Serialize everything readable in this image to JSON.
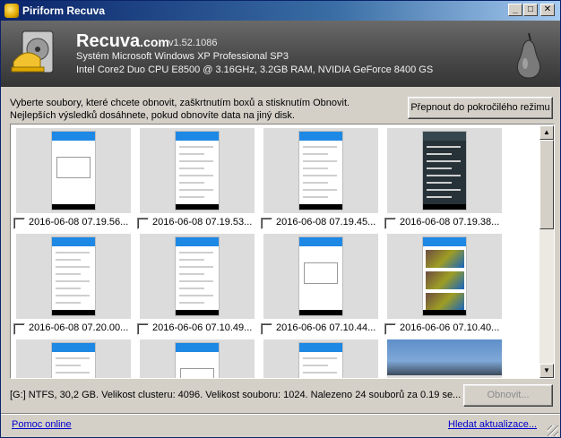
{
  "window": {
    "title": "Piriform Recuva",
    "controls": {
      "minimize": "_",
      "maximize": "□",
      "close": "✕"
    }
  },
  "header": {
    "brand": "Recuva",
    "brand_suffix": ".com",
    "version": "v1.52.1086",
    "os_line": "Systém Microsoft Windows XP Professional SP3",
    "hw_line": "Intel Core2 Duo CPU E8500 @ 3.16GHz, 3.2GB RAM, NVIDIA GeForce 8400 GS",
    "logo_icon": "recuva-logo-icon",
    "pear_icon": "piriform-pear-icon"
  },
  "instructions": {
    "line1": "Vyberte soubory, které chcete obnovit, zaškrtnutím boxů a stisknutím Obnovit.",
    "line2": "Nejlepších výsledků dosáhnete, pokud obnovíte data na jiný disk."
  },
  "advanced_button": "Přepnout do pokročilého režimu",
  "thumbnails": [
    {
      "name": "2016-06-08 07.19.56...",
      "checked": false,
      "style": "dialog"
    },
    {
      "name": "2016-06-08 07.19.53...",
      "checked": false,
      "style": "settings"
    },
    {
      "name": "2016-06-08 07.19.45...",
      "checked": false,
      "style": "list"
    },
    {
      "name": "2016-06-08 07.19.38...",
      "checked": false,
      "style": "dark"
    },
    {
      "name": "2016-06-08 07.20.00...",
      "checked": false,
      "style": "settings"
    },
    {
      "name": "2016-06-06 07.10.49...",
      "checked": false,
      "style": "settings"
    },
    {
      "name": "2016-06-06 07.10.44...",
      "checked": false,
      "style": "dialog"
    },
    {
      "name": "2016-06-06 07.10.40...",
      "checked": false,
      "style": "gallery"
    },
    {
      "name": "",
      "checked": false,
      "style": "settings"
    },
    {
      "name": "",
      "checked": false,
      "style": "dialog"
    },
    {
      "name": "",
      "checked": false,
      "style": "list"
    },
    {
      "name": "",
      "checked": false,
      "style": "landscape"
    }
  ],
  "scrollbar": {
    "up": "▲",
    "down": "▼"
  },
  "status_text": "[G:] NTFS, 30,2 GB. Velikost clusteru: 4096. Velikost souboru: 1024. Nalezeno 24 souborů za 0.19 se...",
  "recover_button": "Obnovit...",
  "footer": {
    "help_link": "Pomoc online",
    "update_link": "Hledat aktualizace..."
  }
}
